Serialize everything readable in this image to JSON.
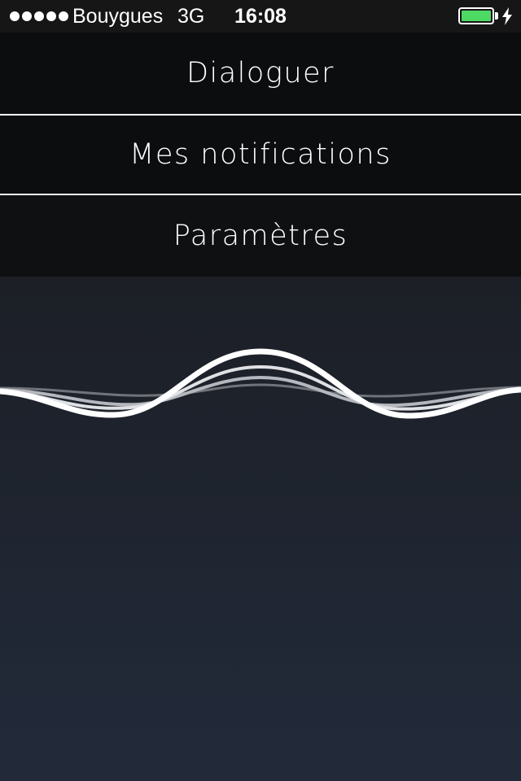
{
  "status_bar": {
    "signal_icon": "signal-dots-icon",
    "signal_bars": 5,
    "carrier": "Bouygues",
    "network": "3G",
    "time": "16:08",
    "battery_icon": "battery-icon",
    "battery_level": 1.0,
    "battery_color": "#4cd964",
    "charging_icon": "charging-bolt-icon"
  },
  "menu": {
    "items": [
      {
        "label": "Dialoguer"
      },
      {
        "label": "Mes notifications"
      },
      {
        "label": "Paramètres"
      }
    ]
  },
  "voice_panel": {
    "waveform_icon": "voice-waveform-icon",
    "accent": "#ffffff"
  }
}
